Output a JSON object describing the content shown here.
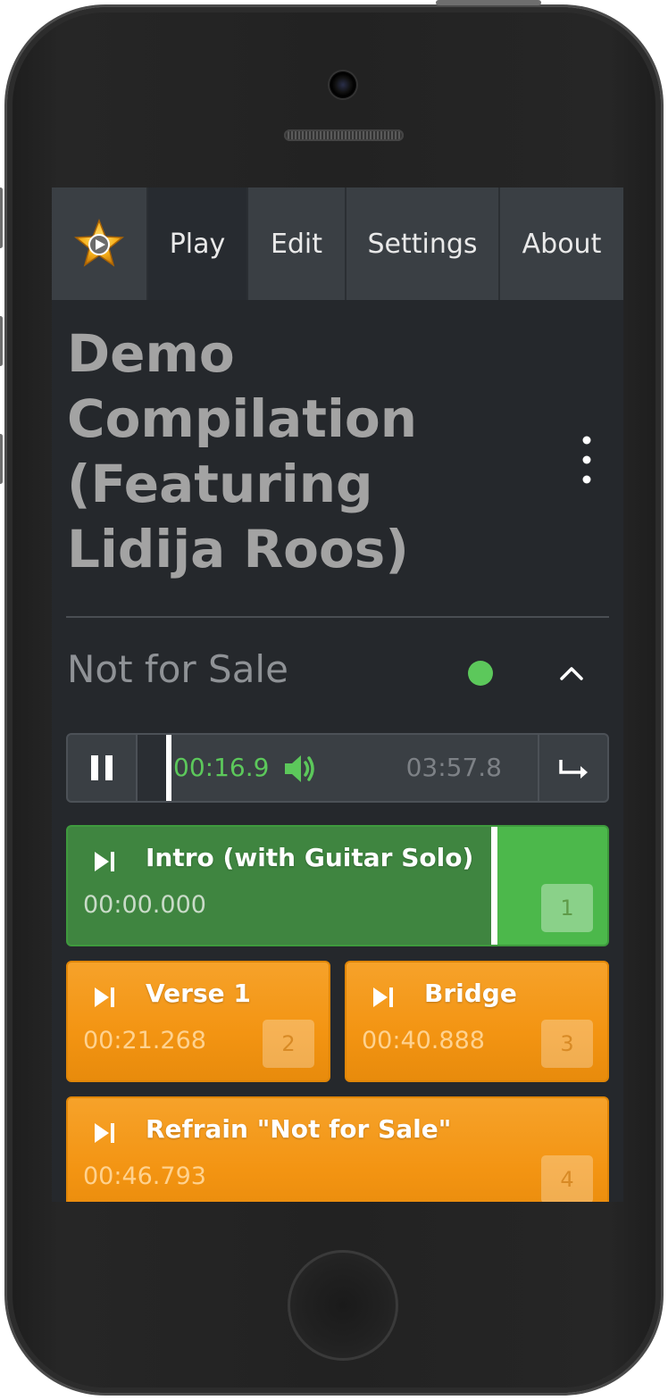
{
  "nav": {
    "brand_icon": "star-play-icon",
    "items": [
      {
        "label": "Play",
        "active": true
      },
      {
        "label": "Edit",
        "active": false
      },
      {
        "label": "Settings",
        "active": false
      },
      {
        "label": "About",
        "active": false
      }
    ]
  },
  "compilation": {
    "title": "Demo Compilation (Featuring Lidija Roos)",
    "menu_icon": "kebab-menu-icon"
  },
  "track": {
    "title": "Not for Sale",
    "status_color": "#5cc85b",
    "collapse_icon": "chevron-up-icon"
  },
  "player": {
    "current_time": "00:16.9",
    "total_time": "03:57.8",
    "progress_fraction": 0.071,
    "current_time_color": "#5cc85b",
    "pause_icon": "pause-icon",
    "volume_icon": "volume-icon",
    "next_icon": "next-cue-icon"
  },
  "cues": [
    {
      "label": "Intro (with Guitar Solo)",
      "time": "00:00.000",
      "shortcut": "1",
      "state": "playing",
      "progress_fraction": 0.78
    },
    {
      "label": "Verse 1",
      "time": "00:21.268",
      "shortcut": "2",
      "state": "idle"
    },
    {
      "label": "Bridge",
      "time": "00:40.888",
      "shortcut": "3",
      "state": "idle"
    },
    {
      "label": "Refrain \"Not for Sale\"",
      "time": "00:46.793",
      "shortcut": "4",
      "state": "idle"
    }
  ],
  "colors": {
    "cue_orange": "#f39412",
    "cue_green": "#4cb84b",
    "background": "#25282c",
    "navbar": "#3a3f44"
  }
}
